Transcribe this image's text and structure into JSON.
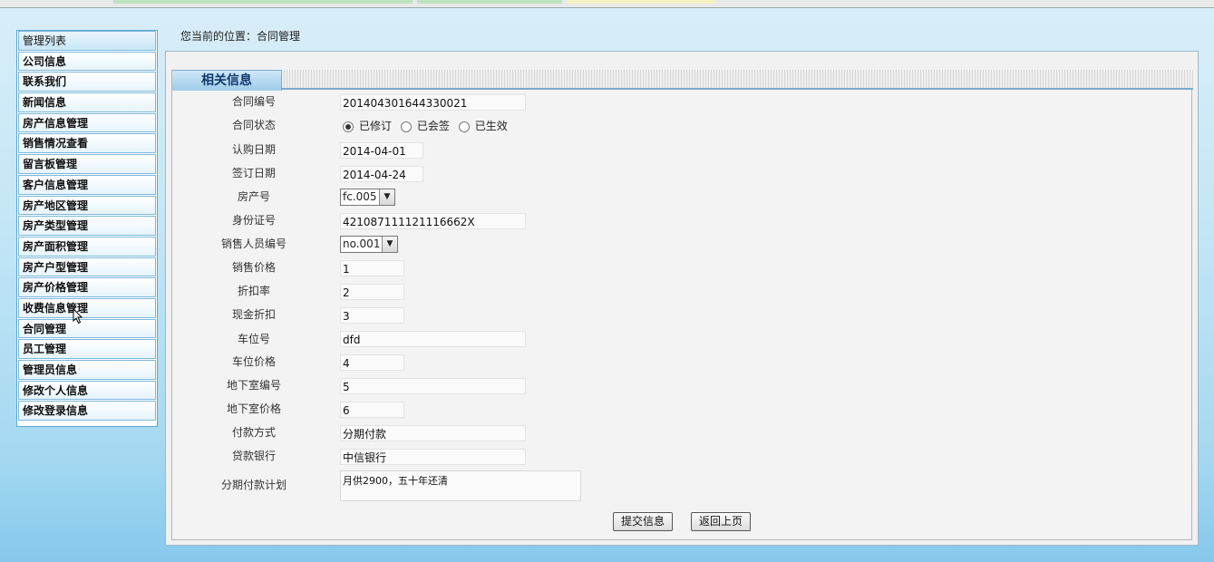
{
  "sidebar": {
    "header": "管理列表",
    "items": [
      "公司信息",
      "联系我们",
      "新闻信息",
      "房产信息管理",
      "销售情况查看",
      "留言板管理",
      "客户信息管理",
      "房产地区管理",
      "房产类型管理",
      "房产面积管理",
      "房产户型管理",
      "房产价格管理",
      "收费信息管理",
      "合同管理",
      "员工管理",
      "管理员信息",
      "修改个人信息",
      "修改登录信息"
    ]
  },
  "breadcrumb": "您当前的位置：合同管理",
  "tab": {
    "label": "相关信息"
  },
  "form": {
    "contract_no": {
      "label": "合同编号",
      "value": "201404301644330021"
    },
    "contract_status": {
      "label": "合同状态",
      "options": [
        "已修订",
        "已会签",
        "已生效"
      ],
      "selected": "已修订"
    },
    "subscribe_date": {
      "label": "认购日期",
      "value": "2014-04-01"
    },
    "sign_date": {
      "label": "签订日期",
      "value": "2014-04-24"
    },
    "property_no": {
      "label": "房产号",
      "value": "fc.005"
    },
    "id_card": {
      "label": "身份证号",
      "value": "421087111121116662X"
    },
    "sales_person": {
      "label": "销售人员编号",
      "value": "no.001"
    },
    "sale_price": {
      "label": "销售价格",
      "value": "1"
    },
    "discount_rate": {
      "label": "折扣率",
      "value": "2"
    },
    "cash_discount": {
      "label": "现金折扣",
      "value": "3"
    },
    "parking_no": {
      "label": "车位号",
      "value": "dfd"
    },
    "parking_price": {
      "label": "车位价格",
      "value": "4"
    },
    "basement_no": {
      "label": "地下室编号",
      "value": "5"
    },
    "basement_price": {
      "label": "地下室价格",
      "value": "6"
    },
    "payment_method": {
      "label": "付款方式",
      "value": "分期付款"
    },
    "loan_bank": {
      "label": "贷款银行",
      "value": "中信银行"
    },
    "installment_plan": {
      "label": "分期付款计划",
      "value": "月供2900，五十年还清"
    }
  },
  "buttons": {
    "submit": "提交信息",
    "back": "返回上页"
  }
}
